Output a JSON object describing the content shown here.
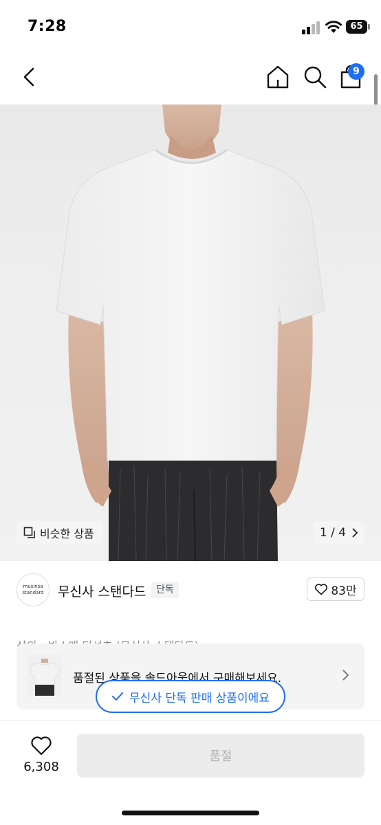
{
  "status_bar": {
    "time": "7:28",
    "battery": "65"
  },
  "nav": {
    "cart_count": "9"
  },
  "gallery": {
    "similar_label": "비슷한 상품",
    "page_counter": "1 / 4"
  },
  "brand": {
    "logo_line1": "musinsa",
    "logo_line2": "standard",
    "name": "무신사 스탠다드",
    "tag": "단독",
    "likes": "83만"
  },
  "breadcrumb": "상의 › 반소매 티셔츠 (무신사 스탠다드)",
  "soldout_banner": {
    "text": "품절된 상품을 솔드아웃에서 구매해보세요."
  },
  "exclusive_pill": {
    "text": "무신사 단독 판매 상품이에요"
  },
  "bottom_bar": {
    "wish_count": "6,308",
    "buy_label": "품절"
  },
  "colors": {
    "accent": "#1e6ef4",
    "button_disabled": "#ececed"
  }
}
